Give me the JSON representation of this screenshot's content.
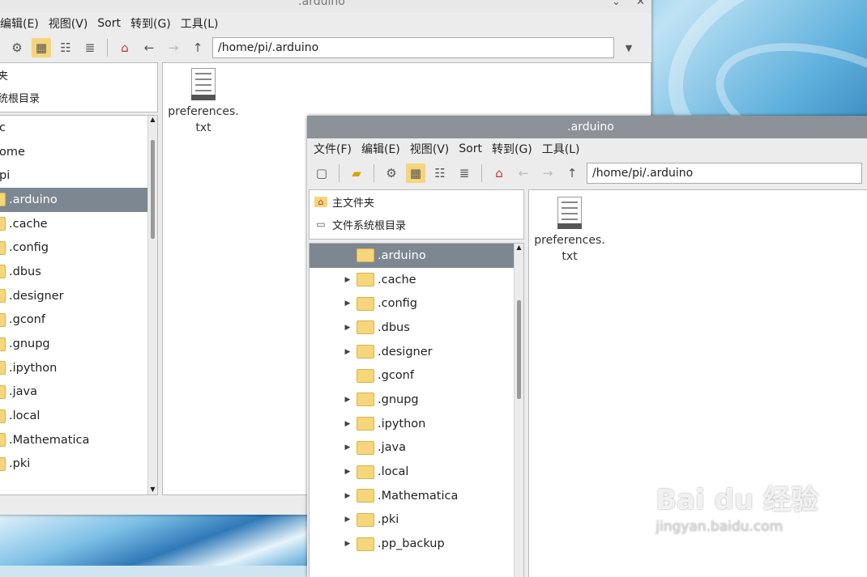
{
  "back_window": {
    "title": ".arduino",
    "menu": [
      "编辑(E)",
      "视图(V)",
      "Sort",
      "转到(G)",
      "工具(L)"
    ],
    "path": "/home/pi/.arduino",
    "places": [
      "夹",
      "统根目录"
    ],
    "tree": [
      {
        "label": "c",
        "folder": false
      },
      {
        "label": "ome",
        "folder": false
      },
      {
        "label": "pi",
        "folder": false
      },
      {
        "label": ".arduino",
        "folder": true,
        "selected": true
      },
      {
        "label": ".cache",
        "folder": true
      },
      {
        "label": ".config",
        "folder": true
      },
      {
        "label": ".dbus",
        "folder": true
      },
      {
        "label": ".designer",
        "folder": true
      },
      {
        "label": ".gconf",
        "folder": true
      },
      {
        "label": ".gnupg",
        "folder": true
      },
      {
        "label": ".ipython",
        "folder": true
      },
      {
        "label": ".java",
        "folder": true
      },
      {
        "label": ".local",
        "folder": true
      },
      {
        "label": ".Mathematica",
        "folder": true
      },
      {
        "label": ".pki",
        "folder": true
      }
    ],
    "file": {
      "line1": "preferences.",
      "line2": "txt"
    }
  },
  "front_window": {
    "title": ".arduino",
    "menu": [
      "文件(F)",
      "编辑(E)",
      "视图(V)",
      "Sort",
      "转到(G)",
      "工具(L)"
    ],
    "path": "/home/pi/.arduino",
    "places": [
      {
        "label": "主文件夹",
        "icon": "home-icon"
      },
      {
        "label": "文件系统根目录",
        "icon": "drive-icon"
      }
    ],
    "tree": [
      {
        "label": ".arduino",
        "expander": false,
        "selected": true
      },
      {
        "label": ".cache",
        "expander": true
      },
      {
        "label": ".config",
        "expander": true
      },
      {
        "label": ".dbus",
        "expander": true
      },
      {
        "label": ".designer",
        "expander": true
      },
      {
        "label": ".gconf",
        "expander": false
      },
      {
        "label": ".gnupg",
        "expander": true
      },
      {
        "label": ".ipython",
        "expander": true
      },
      {
        "label": ".java",
        "expander": true
      },
      {
        "label": ".local",
        "expander": true
      },
      {
        "label": ".Mathematica",
        "expander": true
      },
      {
        "label": ".pki",
        "expander": true
      },
      {
        "label": ".pp_backup",
        "expander": true
      }
    ],
    "file": {
      "line1": "preferences.",
      "line2": "txt"
    }
  },
  "watermark": {
    "logo": "Bai du 经验",
    "url": "jingyan.baidu.com"
  },
  "colors": {
    "titlebar_front": "#8c9297",
    "titlebar_back": "#e8e8e8",
    "selection": "#7d8791",
    "active_button": "#f6d57a"
  }
}
